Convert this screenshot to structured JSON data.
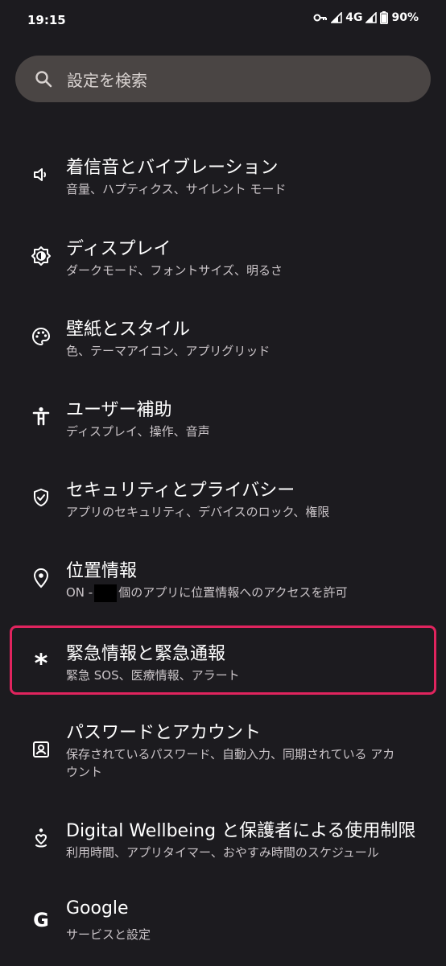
{
  "status_bar": {
    "time": "19:15",
    "network": "4G",
    "battery": "90%"
  },
  "search": {
    "placeholder": "設定を検索"
  },
  "settings_items": [
    {
      "title": "着信音とバイブレーション",
      "summary": "音量、ハプティクス、サイレント モード",
      "icon": "volume-icon"
    },
    {
      "title": "ディスプレイ",
      "summary": "ダークモード、フォントサイズ、明るさ",
      "icon": "brightness-icon"
    },
    {
      "title": "壁紙とスタイル",
      "summary": "色、テーマアイコン、アプリグリッド",
      "icon": "palette-icon"
    },
    {
      "title": "ユーザー補助",
      "summary": "ディスプレイ、操作、音声",
      "icon": "accessibility-icon"
    },
    {
      "title": "セキュリティとプライバシー",
      "summary": "アプリのセキュリティ、デバイスのロック、権限",
      "icon": "shield-icon"
    },
    {
      "title": "位置情報",
      "summary_prefix": "ON -",
      "summary_suffix": "個のアプリに位置情報へのアクセスを許可",
      "icon": "location-pin-icon"
    },
    {
      "title": "緊急情報と緊急通報",
      "summary": "緊急 SOS、医療情報、アラート",
      "icon": "asterisk-icon"
    },
    {
      "title": "パスワードとアカウント",
      "summary": "保存されているパスワード、自動入力、同期されている アカウント",
      "icon": "account-box-icon"
    },
    {
      "title": "Digital Wellbeing と保護者による使用制限",
      "summary": "利用時間、アプリタイマー、おやすみ時間のスケジュール",
      "icon": "wellbeing-icon"
    },
    {
      "title": "Google",
      "summary": "サービスと設定",
      "icon": "google-icon",
      "icon_glyph": "G"
    }
  ],
  "highlight_color": "#e0245e"
}
